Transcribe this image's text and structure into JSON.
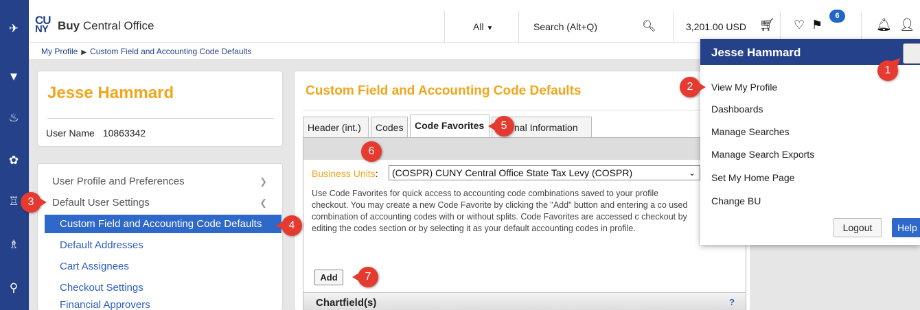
{
  "app": {
    "logo_top": "CU",
    "logo_bottom": "NY",
    "name_bold": "Buy",
    "name_rest": " Central Office"
  },
  "topbar": {
    "filter_label": "All",
    "search_placeholder": "Search (Alt+Q)",
    "cart_total": "3,201.00 USD",
    "flag_count": "6",
    "icons": [
      "chevron-down-icon",
      "search-icon",
      "cart-icon",
      "heart-icon",
      "flag-icon",
      "bell-icon",
      "user-icon"
    ]
  },
  "breadcrumb": {
    "items": [
      "My Profile",
      "Custom Field and Accounting Code Defaults"
    ]
  },
  "profile": {
    "name": "Jesse Hammard",
    "username_label": "User Name",
    "username_value": "10863342"
  },
  "sidebar": {
    "items": [
      {
        "label": "User Profile and Preferences"
      },
      {
        "label": "Default User Settings"
      },
      {
        "label": "Custom Field and Accounting Code Defaults"
      },
      {
        "label": "Default Addresses"
      },
      {
        "label": "Cart Assignees"
      },
      {
        "label": "Checkout Settings"
      },
      {
        "label": "Financial Approvers"
      }
    ]
  },
  "main": {
    "title": "Custom Field and Accounting Code Defaults",
    "tabs": [
      {
        "label": "Header (int.)"
      },
      {
        "label": "Codes"
      },
      {
        "label": "Code Favorites"
      },
      {
        "label": "nal Information"
      }
    ],
    "business_units_label": "Business Units",
    "business_units_colon": ":",
    "business_units_value": "(COSPR) CUNY Central Office State Tax Levy (COSPR)",
    "help_text": "Use Code Favorites for quick access to accounting code combinations saved to your profile checkout. You may create a new Code Favorite by clicking the \"Add\" button and entering a co used combination of accounting codes with or without splits. Code Favorites are accessed c checkout by editing the codes section or by selecting it as your default accounting codes in profile.",
    "add_label": "Add",
    "chartfield_label": "Chartfield(s)",
    "chartfield_help": "?"
  },
  "user_menu": {
    "name": "Jesse Hammard",
    "items": [
      {
        "label": "View My Profile"
      },
      {
        "label": "Dashboards"
      },
      {
        "label": "Manage Searches"
      },
      {
        "label": "Manage Search Exports"
      },
      {
        "label": "Set My Home Page"
      },
      {
        "label": "Change BU"
      }
    ],
    "logout_label": "Logout",
    "help_label": "Help"
  },
  "callouts": [
    "1",
    "2",
    "3",
    "4",
    "5",
    "6",
    "7"
  ],
  "colors": {
    "brand_blue": "#24418a",
    "accent_orange": "#f3a51a",
    "active_blue": "#2e68c8",
    "callout_red": "#e53a2f"
  }
}
